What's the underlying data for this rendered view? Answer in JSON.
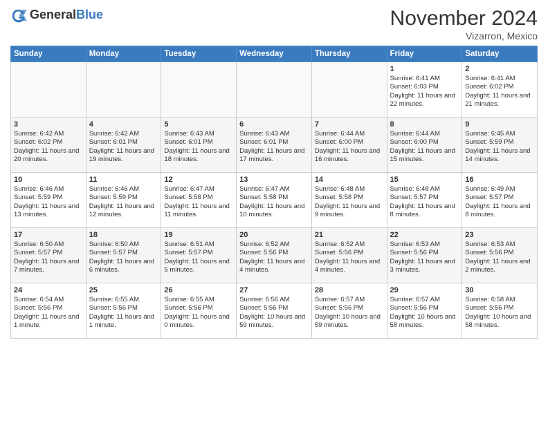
{
  "header": {
    "logo_general": "General",
    "logo_blue": "Blue",
    "title": "November 2024",
    "location": "Vizarron, Mexico"
  },
  "days_of_week": [
    "Sunday",
    "Monday",
    "Tuesday",
    "Wednesday",
    "Thursday",
    "Friday",
    "Saturday"
  ],
  "weeks": [
    [
      {
        "day": "",
        "info": ""
      },
      {
        "day": "",
        "info": ""
      },
      {
        "day": "",
        "info": ""
      },
      {
        "day": "",
        "info": ""
      },
      {
        "day": "",
        "info": ""
      },
      {
        "day": "1",
        "info": "Sunrise: 6:41 AM\nSunset: 6:03 PM\nDaylight: 11 hours and 22 minutes."
      },
      {
        "day": "2",
        "info": "Sunrise: 6:41 AM\nSunset: 6:02 PM\nDaylight: 11 hours and 21 minutes."
      }
    ],
    [
      {
        "day": "3",
        "info": "Sunrise: 6:42 AM\nSunset: 6:02 PM\nDaylight: 11 hours and 20 minutes."
      },
      {
        "day": "4",
        "info": "Sunrise: 6:42 AM\nSunset: 6:01 PM\nDaylight: 11 hours and 19 minutes."
      },
      {
        "day": "5",
        "info": "Sunrise: 6:43 AM\nSunset: 6:01 PM\nDaylight: 11 hours and 18 minutes."
      },
      {
        "day": "6",
        "info": "Sunrise: 6:43 AM\nSunset: 6:01 PM\nDaylight: 11 hours and 17 minutes."
      },
      {
        "day": "7",
        "info": "Sunrise: 6:44 AM\nSunset: 6:00 PM\nDaylight: 11 hours and 16 minutes."
      },
      {
        "day": "8",
        "info": "Sunrise: 6:44 AM\nSunset: 6:00 PM\nDaylight: 11 hours and 15 minutes."
      },
      {
        "day": "9",
        "info": "Sunrise: 6:45 AM\nSunset: 5:59 PM\nDaylight: 11 hours and 14 minutes."
      }
    ],
    [
      {
        "day": "10",
        "info": "Sunrise: 6:46 AM\nSunset: 5:59 PM\nDaylight: 11 hours and 13 minutes."
      },
      {
        "day": "11",
        "info": "Sunrise: 6:46 AM\nSunset: 5:59 PM\nDaylight: 11 hours and 12 minutes."
      },
      {
        "day": "12",
        "info": "Sunrise: 6:47 AM\nSunset: 5:58 PM\nDaylight: 11 hours and 11 minutes."
      },
      {
        "day": "13",
        "info": "Sunrise: 6:47 AM\nSunset: 5:58 PM\nDaylight: 11 hours and 10 minutes."
      },
      {
        "day": "14",
        "info": "Sunrise: 6:48 AM\nSunset: 5:58 PM\nDaylight: 11 hours and 9 minutes."
      },
      {
        "day": "15",
        "info": "Sunrise: 6:48 AM\nSunset: 5:57 PM\nDaylight: 11 hours and 8 minutes."
      },
      {
        "day": "16",
        "info": "Sunrise: 6:49 AM\nSunset: 5:57 PM\nDaylight: 11 hours and 8 minutes."
      }
    ],
    [
      {
        "day": "17",
        "info": "Sunrise: 6:50 AM\nSunset: 5:57 PM\nDaylight: 11 hours and 7 minutes."
      },
      {
        "day": "18",
        "info": "Sunrise: 6:50 AM\nSunset: 5:57 PM\nDaylight: 11 hours and 6 minutes."
      },
      {
        "day": "19",
        "info": "Sunrise: 6:51 AM\nSunset: 5:57 PM\nDaylight: 11 hours and 5 minutes."
      },
      {
        "day": "20",
        "info": "Sunrise: 6:52 AM\nSunset: 5:56 PM\nDaylight: 11 hours and 4 minutes."
      },
      {
        "day": "21",
        "info": "Sunrise: 6:52 AM\nSunset: 5:56 PM\nDaylight: 11 hours and 4 minutes."
      },
      {
        "day": "22",
        "info": "Sunrise: 6:53 AM\nSunset: 5:56 PM\nDaylight: 11 hours and 3 minutes."
      },
      {
        "day": "23",
        "info": "Sunrise: 6:53 AM\nSunset: 5:56 PM\nDaylight: 11 hours and 2 minutes."
      }
    ],
    [
      {
        "day": "24",
        "info": "Sunrise: 6:54 AM\nSunset: 5:56 PM\nDaylight: 11 hours and 1 minute."
      },
      {
        "day": "25",
        "info": "Sunrise: 6:55 AM\nSunset: 5:56 PM\nDaylight: 11 hours and 1 minute."
      },
      {
        "day": "26",
        "info": "Sunrise: 6:55 AM\nSunset: 5:56 PM\nDaylight: 11 hours and 0 minutes."
      },
      {
        "day": "27",
        "info": "Sunrise: 6:56 AM\nSunset: 5:56 PM\nDaylight: 10 hours and 59 minutes."
      },
      {
        "day": "28",
        "info": "Sunrise: 6:57 AM\nSunset: 5:56 PM\nDaylight: 10 hours and 59 minutes."
      },
      {
        "day": "29",
        "info": "Sunrise: 6:57 AM\nSunset: 5:56 PM\nDaylight: 10 hours and 58 minutes."
      },
      {
        "day": "30",
        "info": "Sunrise: 6:58 AM\nSunset: 5:56 PM\nDaylight: 10 hours and 58 minutes."
      }
    ]
  ]
}
